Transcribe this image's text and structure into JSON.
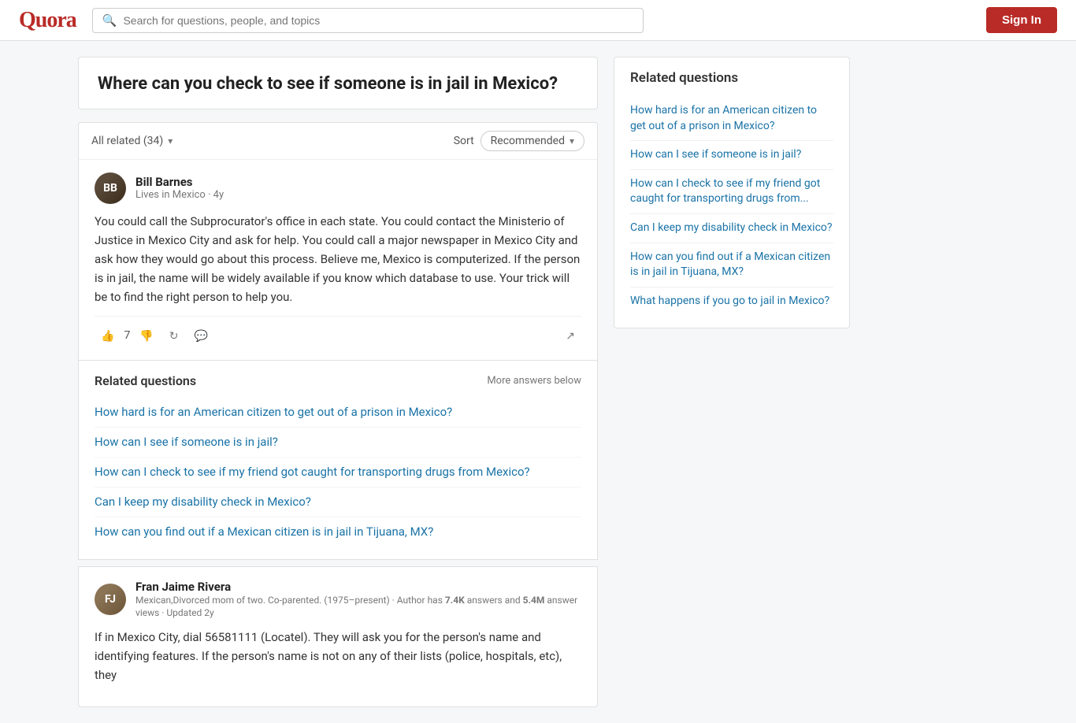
{
  "header": {
    "logo": "Quora",
    "search_placeholder": "Search for questions, people, and topics",
    "sign_in_label": "Sign In"
  },
  "main": {
    "question": {
      "title": "Where can you check to see if someone is in jail in Mexico?"
    },
    "answers_meta": {
      "all_related_label": "All related (34)",
      "sort_label": "Sort",
      "sort_value": "Recommended"
    },
    "answers": [
      {
        "id": "bill-barnes",
        "author_name": "Bill Barnes",
        "author_meta": "Lives in Mexico · 4y",
        "avatar_type": "bb",
        "text": "You could call the Subprocurator's office in each state. You could contact the Ministerio of Justice in Mexico City and ask for help. You could call a major newspaper in Mexico City and ask how they would go about this process. Believe me, Mexico is computerized. If the person is in jail, the name will be widely available if you know which database to use. Your trick will be to find the right person to help you.",
        "vote_count": "7"
      }
    ],
    "related_inline": {
      "title": "Related questions",
      "more_label": "More answers below",
      "links": [
        "How hard is for an American citizen to get out of a prison in Mexico?",
        "How can I see if someone is in jail?",
        "How can I check to see if my friend got caught for transporting drugs from Mexico?",
        "Can I keep my disability check in Mexico?",
        "How can you find out if a Mexican citizen is in jail in Tijuana, MX?"
      ]
    },
    "second_answer": {
      "id": "fran-jaime-rivera",
      "author_name": "Fran Jaime Rivera",
      "author_meta": "Mexican,Divorced mom of two. Co-parented. (1975–present) · Author has ",
      "author_meta_bold1": "7.4K",
      "author_meta2": " answers and ",
      "author_meta_bold2": "5.4M",
      "author_meta3": " answer views · Updated 2y",
      "avatar_type": "fjr",
      "text": "If in Mexico City, dial 56581111 (Locatel). They will ask you for the person's name and identifying features. If the person's name is not on any of their lists (police, hospitals, etc), they"
    }
  },
  "sidebar": {
    "related_title": "Related questions",
    "links": [
      "How hard is for an American citizen to get out of a prison in Mexico?",
      "How can I see if someone is in jail?",
      "How can I check to see if my friend got caught for transporting drugs from...",
      "Can I keep my disability check in Mexico?",
      "How can you find out if a Mexican citizen is in jail in Tijuana, MX?",
      "What happens if you go to jail in Mexico?"
    ]
  }
}
